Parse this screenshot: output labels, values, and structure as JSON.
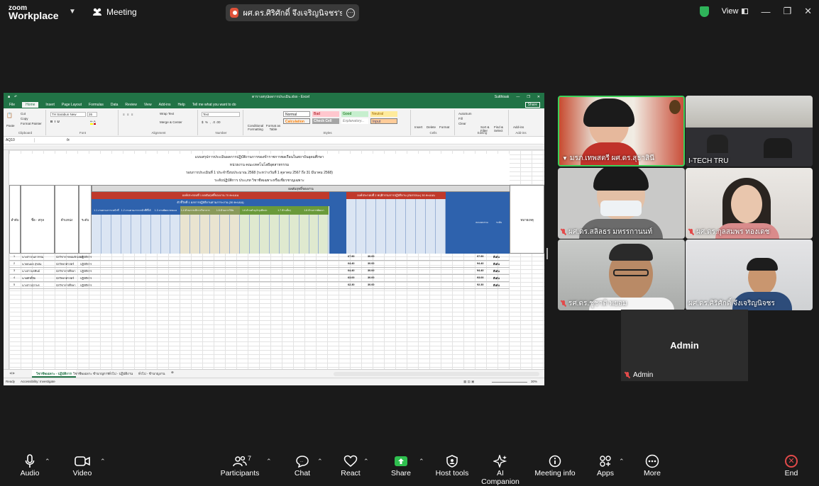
{
  "topbar": {
    "logo_line1": "zoom",
    "logo_line2": "Workplace",
    "meeting_label": "Meeting",
    "share_label": "ผศ.ดร.ศิริศักดิ์ จึงเจริญนิจชร's screen",
    "view_label": "View"
  },
  "excel": {
    "title": "ตารางสรุปผลการประเมิน.xlsx - Excel",
    "user": "Sutthisak",
    "tabs": [
      "File",
      "Home",
      "Insert",
      "Page Layout",
      "Formulas",
      "Data",
      "Review",
      "View",
      "Add-ins",
      "Help",
      "Tell me what you want to do"
    ],
    "share": "Share",
    "ribbon": {
      "clipboard": [
        "Cut",
        "Copy",
        "Format Painter"
      ],
      "paste": "Paste",
      "font_name": "TH Sarabun New",
      "font_size": "26",
      "wrap_text": "Wrap Text",
      "merge_center": "Merge & Center",
      "number_format": "Text",
      "conditional": "Conditional Formatting",
      "format_as_table": "Format as Table",
      "styles": [
        {
          "label": "Normal",
          "bg": "#ffffff",
          "fg": "#222222"
        },
        {
          "label": "Bad",
          "bg": "#ffc7ce",
          "fg": "#9c0006"
        },
        {
          "label": "Good",
          "bg": "#c6efce",
          "fg": "#006100"
        },
        {
          "label": "Neutral",
          "bg": "#ffeb9c",
          "fg": "#9c6500"
        },
        {
          "label": "Calculation",
          "bg": "#f2f2f2",
          "fg": "#fa7d00"
        },
        {
          "label": "Check Cell",
          "bg": "#a5a5a5",
          "fg": "#ffffff"
        },
        {
          "label": "Explanatory...",
          "bg": "#ffffff",
          "fg": "#7f7f7f"
        },
        {
          "label": "Input",
          "bg": "#ffcc99",
          "fg": "#3f3f76"
        }
      ],
      "cells": [
        "Insert",
        "Delete",
        "Format"
      ],
      "editing": [
        "AutoSum",
        "Fill",
        "Clear",
        "Sort & Filter",
        "Find & Select"
      ],
      "addins": "Add-ins",
      "groups": [
        "Clipboard",
        "Font",
        "Alignment",
        "Number",
        "Styles",
        "Cells",
        "Editing",
        "Add-ins"
      ]
    },
    "name_box": "AQ10",
    "formula": "fx",
    "sheet": {
      "heading1": "แบบสรุปการประเมินผลการปฏิบัติงานการของข้าราชการพลเรือนในสถาบันอุดมศึกษา",
      "heading2": "หน่วยงาน คณะเทคโนโลยีอุตสาหกรรม",
      "heading3": "รอบการประเมินที่ 1 ประจำปีงบประมาณ 2568 (ระหว่างวันที่ 1 ตุลาคม 2567 ถึง 31 มีนาคม 2568)",
      "heading4": "ระดับปฏิบัติการ ประเภท วิชาชีพเฉพาะหรือเชี่ยวชาญเฉพาะ",
      "col_seq": "ลำดับ",
      "col_name": "ชื่อ - สกุล",
      "col_pos": "ตำแหน่ง",
      "col_level": "ระดับ",
      "col_note": "หมายเหตุ",
      "top_band": "ผลสัมฤทธิ์ของงาน",
      "red_band1": "องค์ประกอบที่ 1 ผลสัมฤทธิ์ของงาน 70 คะแนน",
      "blue_band": "ตัวชี้วัดที่ 1 ผลการปฏิบัติงานตามภาระงาน (30 คะแนน)",
      "red_band2": "องค์ประกอบที่ 2 พฤติกรรมการปฏิบัติงาน (สมรรถนะ) 30 คะแนน",
      "sub_headers": [
        "1.1 งานตามภาระหน้าที่",
        "1.2 งานตามภาระหน้าที่ที่ได้รับมอบหมาย",
        "1.3 งานพัฒนาตนเอง",
        "1.4 ด้านการบริการวิชาการ",
        "1.5 ด้านการวิจัย",
        "1.6 ด้านทำนุบำรุงศิลปะ",
        "1.7 ด้านอื่นๆ",
        "1.8 ด้านการพัฒนาประสิทธิภาพ"
      ],
      "sum_total": "คะแนนรวม",
      "grade": "ระดับ",
      "rows": [
        {
          "seq": "1",
          "name": "นางสาวกนกวรรณ",
          "pos": "นักวิชาการคอมพิวเตอร์",
          "level": "ปฏิบัติการ",
          "p1": "67.90",
          "p2": "30.00",
          "total": "97.90",
          "grade": "ดีเด่น"
        },
        {
          "seq": "2",
          "name": "นายธนพล สุขสม",
          "pos": "นักวิทยาศาสตร์",
          "level": "ปฏิบัติการ",
          "p1": "64.40",
          "p2": "30.00",
          "total": "94.40",
          "grade": "ดีเด่น"
        },
        {
          "seq": "3",
          "name": "นางสาวพรทิพย์",
          "pos": "นักวิชาการศึกษา",
          "level": "ปฏิบัติการ",
          "p1": "64.40",
          "p2": "30.00",
          "total": "94.40",
          "grade": "ดีเด่น"
        },
        {
          "seq": "4",
          "name": "นายศักดิ์ชัย",
          "pos": "นักวิทยาศาสตร์",
          "level": "ปฏิบัติการ",
          "p1": "63.00",
          "p2": "30.00",
          "total": "93.00",
          "grade": "ดีเด่น"
        },
        {
          "seq": "5",
          "name": "นางสาวสุภาพร",
          "pos": "นักวิชาการศึกษา",
          "level": "ปฏิบัติการ",
          "p1": "62.30",
          "p2": "30.00",
          "total": "92.30",
          "grade": "ดีเด่น"
        }
      ]
    },
    "sheet_tabs": [
      "วิชาชีพเฉพาะ - ปฏิบัติการ",
      "วิชาชีพเฉพาะ ชำนาญการ",
      "ทั่วไป - ปฏิบัติงาน",
      "ทั่วไป - ชำนาญงาน"
    ],
    "status_ready": "Ready",
    "status_access": "Accessibility: Investigate",
    "zoom": "30%"
  },
  "participants": [
    {
      "name": "ผศ.ดร.สลิลธร มหรรกานนท์",
      "muted": true
    },
    {
      "name": "ผศ.ดร.กุลสมพร ทองเดช",
      "muted": true
    },
    {
      "name": "รศ.ดร.ชูชาติ พยอม",
      "muted": true
    },
    {
      "name": "ผศ.ดร.ศิริศักดิ์ จึงเจริญนิจชร",
      "muted": false
    },
    {
      "name": "มรภ.เทพสตรี ผศ.ดร.สุธาสินี",
      "muted": false
    },
    {
      "name": "I-TECH TRU",
      "muted": false
    }
  ],
  "admin_tile": {
    "big": "Admin",
    "name": "Admin"
  },
  "toolbar": {
    "audio": "Audio",
    "video": "Video",
    "participants": "Participants",
    "participants_count": "7",
    "chat": "Chat",
    "react": "React",
    "share": "Share",
    "host_tools": "Host tools",
    "ai_companion": "AI Companion",
    "meeting_info": "Meeting info",
    "apps": "Apps",
    "more": "More",
    "end": "End"
  }
}
